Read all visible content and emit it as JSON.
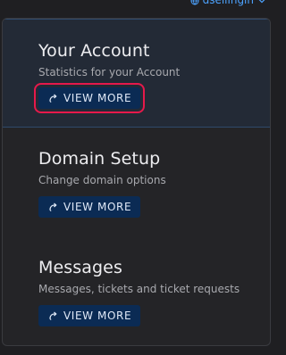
{
  "header": {
    "account_label": "dsellingin",
    "account_icon": "globe-icon",
    "dropdown_icon": "chevron-down-icon"
  },
  "cards": [
    {
      "title": "Your Account",
      "subtitle": "Statistics for your Account",
      "button_label": "VIEW MORE",
      "button_icon": "share-arrow-icon",
      "highlighted": true
    },
    {
      "title": "Domain Setup",
      "subtitle": "Change domain options",
      "button_label": "VIEW MORE",
      "button_icon": "share-arrow-icon",
      "highlighted": false
    },
    {
      "title": "Messages",
      "subtitle": "Messages, tickets and ticket requests",
      "button_label": "VIEW MORE",
      "button_icon": "share-arrow-icon",
      "highlighted": false
    }
  ],
  "colors": {
    "background": "#1f1f22",
    "panel": "#242427",
    "active_card": "#232a36",
    "button": "#0b2b54",
    "highlight": "#e6194b",
    "link": "#4da3ff"
  }
}
